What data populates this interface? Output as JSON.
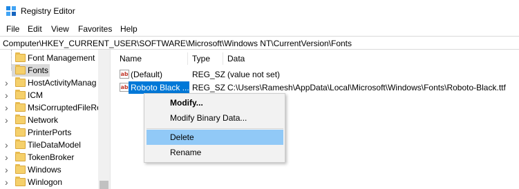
{
  "window": {
    "title": "Registry Editor",
    "app_icon": "registry-editor-icon"
  },
  "menu": [
    "File",
    "Edit",
    "View",
    "Favorites",
    "Help"
  ],
  "address": "Computer\\HKEY_CURRENT_USER\\SOFTWARE\\Microsoft\\Windows NT\\CurrentVersion\\Fonts",
  "tree": [
    {
      "label": "Font Management",
      "expandable": false,
      "selected": false
    },
    {
      "label": "Fonts",
      "expandable": false,
      "selected": true
    },
    {
      "label": "HostActivityManag",
      "expandable": true,
      "selected": false
    },
    {
      "label": "ICM",
      "expandable": true,
      "selected": false
    },
    {
      "label": "MsiCorruptedFileRe",
      "expandable": true,
      "selected": false
    },
    {
      "label": "Network",
      "expandable": true,
      "selected": false
    },
    {
      "label": "PrinterPorts",
      "expandable": false,
      "selected": false
    },
    {
      "label": "TileDataModel",
      "expandable": true,
      "selected": false
    },
    {
      "label": "TokenBroker",
      "expandable": true,
      "selected": false
    },
    {
      "label": "Windows",
      "expandable": true,
      "selected": false
    },
    {
      "label": "Winlogon",
      "expandable": true,
      "selected": false
    }
  ],
  "list": {
    "columns": [
      "Name",
      "Type",
      "Data"
    ],
    "rows": [
      {
        "name": "(Default)",
        "type": "REG_SZ",
        "data": "(value not set)",
        "selected": false,
        "icon": "string-value-icon"
      },
      {
        "name": "Roboto Black ...",
        "type": "REG_SZ",
        "data": "C:\\Users\\Ramesh\\AppData\\Local\\Microsoft\\Windows\\Fonts\\Roboto-Black.ttf",
        "selected": true,
        "icon": "string-value-icon"
      }
    ]
  },
  "context_menu": [
    {
      "label": "Modify...",
      "bold": true,
      "hover": false
    },
    {
      "label": "Modify Binary Data...",
      "bold": false,
      "hover": false
    },
    {
      "label": "Delete",
      "bold": false,
      "hover": true
    },
    {
      "label": "Rename",
      "bold": false,
      "hover": false
    }
  ],
  "colors": {
    "selection": "#0078d7",
    "menu_hover": "#91c9f7",
    "folder": "#f5d06b"
  }
}
